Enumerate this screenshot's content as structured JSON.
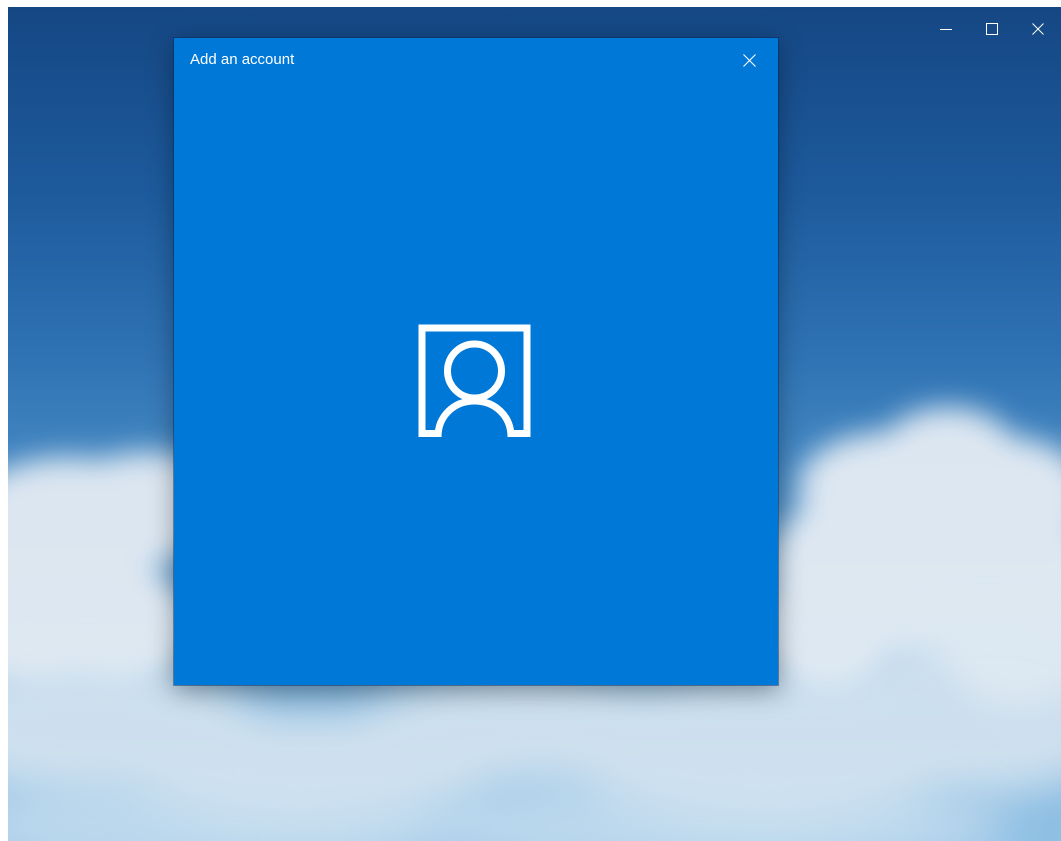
{
  "window": {
    "controls": [
      {
        "name": "minimize",
        "icon": "minimize-icon"
      },
      {
        "name": "maximize",
        "icon": "maximize-icon"
      },
      {
        "name": "close",
        "icon": "close-icon"
      }
    ]
  },
  "dialog": {
    "title": "Add an account",
    "close_icon": "close-icon",
    "center_icon": "person-account-icon",
    "background_color": "#0078d7"
  },
  "colors": {
    "accent": "#0078d7",
    "icon": "#ffffff"
  }
}
